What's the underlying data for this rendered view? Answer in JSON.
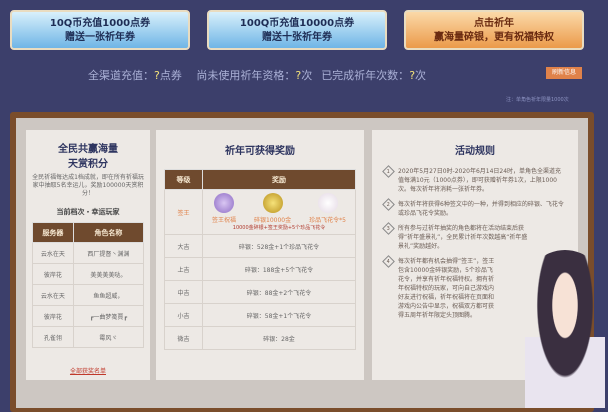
{
  "banners": [
    {
      "line1": "10Q币充值1000点券",
      "line2": "赠送一张祈年券"
    },
    {
      "line1": "100Q币充值10000点券",
      "line2": "赠送十张祈年券"
    },
    {
      "line1": "点击祈年",
      "line2": "赢海量碎银，更有祝福特权"
    }
  ],
  "stats": {
    "recharge_label": "全渠道充值：",
    "recharge_value": "?",
    "recharge_unit": "点券",
    "unused_label": "尚未使用祈年资格：",
    "unused_value": "?",
    "unused_unit": "次",
    "done_label": "已完成祈年次数：",
    "done_value": "?",
    "done_unit": "次"
  },
  "refresh_label": "刷新信息",
  "note": "注：单角色祈年限量1000次",
  "left": {
    "title1": "全民共赢海量",
    "title2": "天赏积分",
    "desc": "全民祈福每达成1档成就，即在所有祈福玩家中抽取5名幸运儿，奖励100000天赏积分！",
    "subtitle": "当前档次・幸运玩家",
    "headers": [
      "服务器",
      "角色名称"
    ],
    "rows": [
      [
        "云水在天",
        "西厂提督丶渊渊"
      ],
      [
        "彼岸花",
        "美美美美哒。"
      ],
      [
        "云水在天",
        "鱼鱼超威，"
      ],
      [
        "彼岸花",
        "┏一曲梦笺賈┏"
      ],
      [
        "孔雀翎",
        "霉风ヾ"
      ]
    ],
    "link": "全部获奖名单"
  },
  "middle": {
    "title": "祈年可获得奖励",
    "headers": [
      "等级",
      "奖励"
    ],
    "top": {
      "level": "签王",
      "items": [
        "签王祝福",
        "碎银10000金",
        "珍品飞花令*5"
      ],
      "summary": "10000金碎银+签王奖励+5个珍品飞花令"
    },
    "rows": [
      [
        "大吉",
        "碎银：528金+1个珍品飞花令"
      ],
      [
        "上吉",
        "碎银：188金+5个飞花令"
      ],
      [
        "中吉",
        "碎银：88金+2个飞花令"
      ],
      [
        "小吉",
        "碎银：58金+1个飞花令"
      ],
      [
        "微吉",
        "碎银：28金"
      ]
    ]
  },
  "right": {
    "title": "活动规则",
    "rules": [
      {
        "n": "1",
        "text": "2020年5月27日0时-2020年6月14日24时，单角色全渠道充值每满10元（1000点券），即可获赠祈年券1次，上限1000次。每次祈年将消耗一张祈年券。"
      },
      {
        "n": "2",
        "text": "每次祈年将获得6种签文中的一种，并得到相应的碎银、飞花令或珍品飞花令奖励。"
      },
      {
        "n": "3",
        "text": "所有参与过祈年抽奖的角色都将在活动结束后获得“祈年盛景礼”，全民累计祈年次数越高“祈年盛景礼”奖励越好。"
      },
      {
        "n": "4",
        "text": "每次祈年都有机会抽得“签王”，签王包含10000金碎银奖励，5个珍品飞花令，并享有祈年祝福特权。拥有祈年祝福特权的玩家，可向自己游戏内好友进行祝福，祈年祝福将在页面和游戏内公告中显示，祝福双方都可获得五周年祈年限定头顶图腾。"
      }
    ]
  },
  "colors": {
    "bg": "#3c3f6b",
    "frame": "#7a4d2b",
    "table_header": "#6f4a2e",
    "accent": "#e0824a"
  }
}
